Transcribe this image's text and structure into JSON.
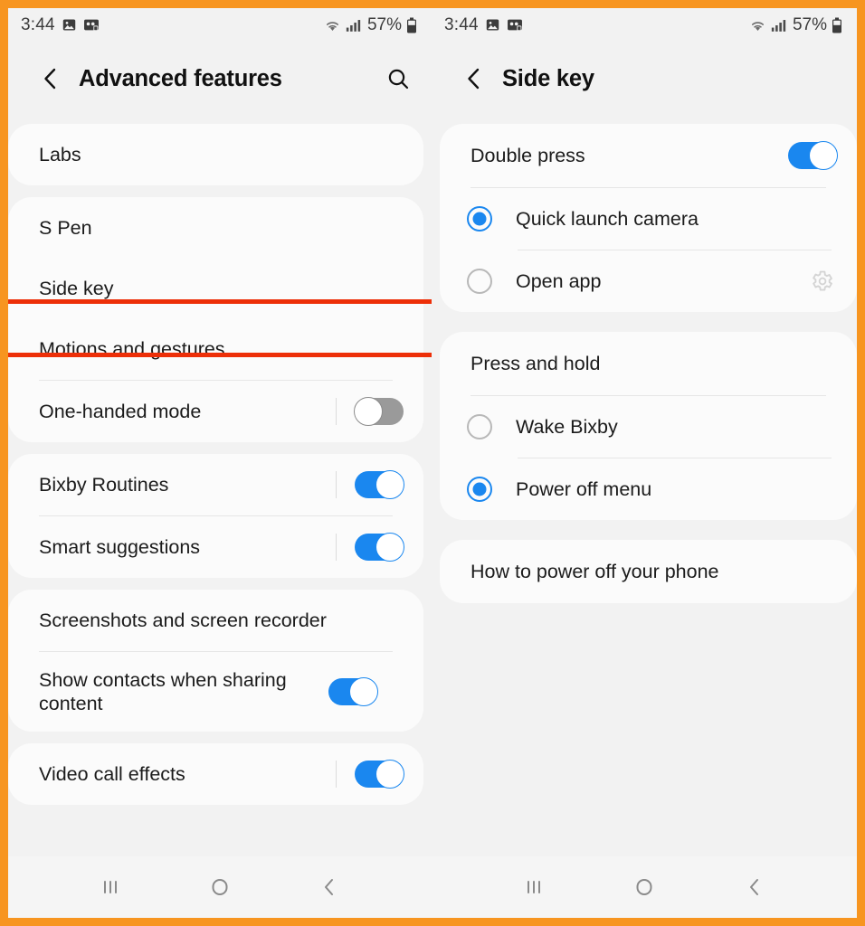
{
  "accent": {
    "frame_border": "#f79520",
    "highlight": "#ed2f08",
    "toggle_on": "#1a87ef",
    "toggle_off": "#9a9a9a",
    "card_bg": "#fbfbfb",
    "page_bg": "#f2f2f2"
  },
  "left": {
    "status": {
      "time": "3:44",
      "icons_left": [
        "image-icon",
        "screen-record-icon"
      ],
      "wifi": "wifi-icon",
      "signal": "cellular-signal-icon",
      "battery_percent": "57%",
      "battery": "battery-icon"
    },
    "appbar": {
      "back": "back-chevron-icon",
      "title": "Advanced features",
      "search": "search-icon"
    },
    "cards": [
      {
        "rows": [
          {
            "label": "Labs",
            "control": "none"
          }
        ]
      },
      {
        "rows": [
          {
            "label": "S Pen",
            "control": "none"
          },
          {
            "label": "Side key",
            "control": "none",
            "highlighted": true
          },
          {
            "label": "Motions and gestures",
            "control": "none"
          },
          {
            "label": "One-handed mode",
            "control": "toggle",
            "toggle_on": false
          }
        ]
      },
      {
        "rows": [
          {
            "label": "Bixby Routines",
            "control": "toggle",
            "toggle_on": true
          },
          {
            "label": "Smart suggestions",
            "control": "toggle",
            "toggle_on": true
          }
        ]
      },
      {
        "rows": [
          {
            "label": "Screenshots and screen recorder",
            "control": "none"
          },
          {
            "label": "Show contacts when sharing content",
            "control": "toggle",
            "toggle_on": true
          }
        ]
      },
      {
        "rows": [
          {
            "label": "Video call effects",
            "control": "toggle",
            "toggle_on": true
          }
        ]
      }
    ],
    "nav": [
      "recents-icon",
      "home-icon",
      "back-icon"
    ]
  },
  "right": {
    "status": {
      "time": "3:44",
      "icons_left": [
        "image-icon",
        "screen-record-icon"
      ],
      "wifi": "wifi-icon",
      "signal": "cellular-signal-icon",
      "battery_percent": "57%",
      "battery": "battery-icon"
    },
    "appbar": {
      "back": "back-chevron-icon",
      "title": "Side key",
      "search": null
    },
    "cards": [
      {
        "rows": [
          {
            "label": "Double press",
            "control": "toggle",
            "toggle_on": true
          },
          {
            "label": "Quick launch camera",
            "control": "radio",
            "selected": true
          },
          {
            "label": "Open app",
            "control": "radio",
            "selected": false,
            "trailing": "gear-icon"
          }
        ]
      },
      {
        "rows": [
          {
            "label": "Press and hold",
            "control": "none"
          },
          {
            "label": "Wake Bixby",
            "control": "radio",
            "selected": false
          },
          {
            "label": "Power off menu",
            "control": "radio",
            "selected": true
          }
        ]
      },
      {
        "rows": [
          {
            "label": "How to power off your phone",
            "control": "none"
          }
        ]
      }
    ],
    "nav": [
      "recents-icon",
      "home-icon",
      "back-icon"
    ]
  }
}
